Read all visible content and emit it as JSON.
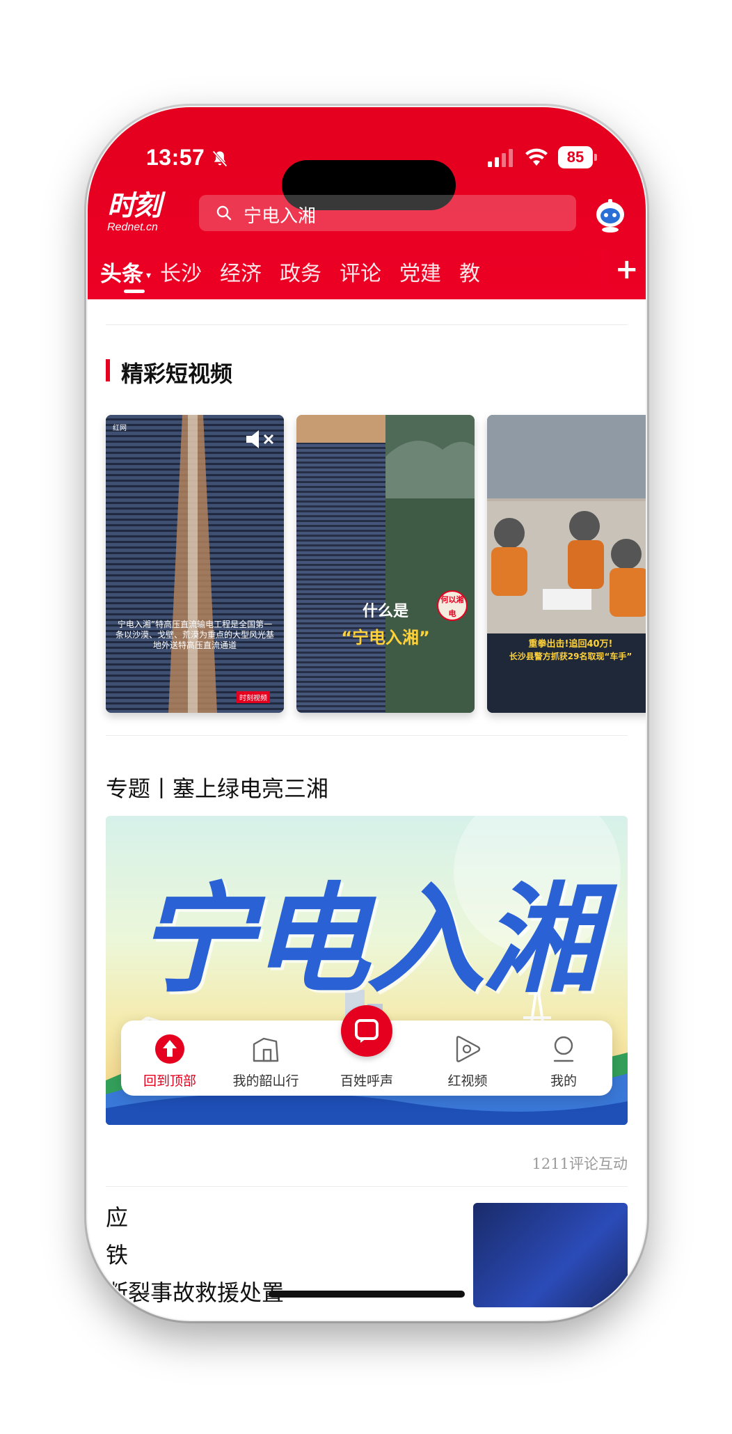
{
  "status": {
    "time": "13:57",
    "battery": "85"
  },
  "app": {
    "logo_main": "时刻",
    "logo_sub": "Rednet.cn"
  },
  "search": {
    "text": "宁电入湘"
  },
  "tabs": [
    "头条",
    "长沙",
    "经济",
    "政务",
    "评论",
    "党建",
    "教"
  ],
  "section_videos": {
    "title": "精彩短视频",
    "video1": {
      "brand": "红网",
      "brand2": "时刻视频",
      "caption": "宁电入湘”特高压直流输电工程是全国第一条以沙漠、戈壁、荒漠为重点的大型风光基地外送特高压直流通道"
    },
    "video2": {
      "line1": "什么是",
      "line2": "“宁电入湘”",
      "badge": "何以湘电"
    },
    "video3": {
      "line1": "重拳出击!追回40万!",
      "line2": "长沙县警方抓获29名取现“车手”"
    }
  },
  "topic": {
    "title": "专题丨塞上绿电亮三湘",
    "banner_text": "宁电入湘",
    "meta": "1211评论互动"
  },
  "next_item": {
    "line1": "应",
    "line2": "铁",
    "line3": "断裂事故救援处置"
  },
  "tabbar": {
    "items": [
      "回到顶部",
      "我的韶山行",
      "百姓呼声",
      "红视频",
      "我的"
    ],
    "active_color": "#e4001e"
  }
}
